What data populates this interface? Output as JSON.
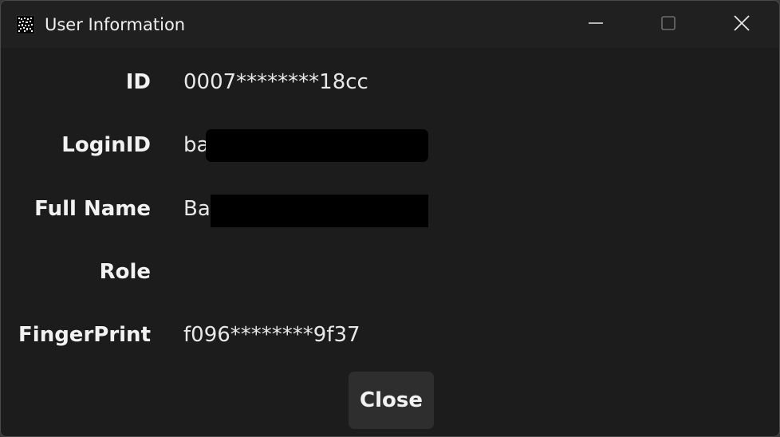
{
  "window": {
    "title": "User Information",
    "app_icon": "qr-pattern-icon",
    "controls": {
      "minimize_icon": "minimize-icon",
      "maximize_icon": "maximize-icon",
      "close_icon": "close-icon"
    }
  },
  "fields": [
    {
      "label": "ID",
      "value": "0007********18cc",
      "redacted": false
    },
    {
      "label": "LoginID",
      "value": "ba",
      "redacted": true
    },
    {
      "label": "Full Name",
      "value": "Ba",
      "redacted": true
    },
    {
      "label": "Role",
      "value": "",
      "redacted": false
    },
    {
      "label": "FingerPrint",
      "value": "f096********9f37",
      "redacted": false
    }
  ],
  "actions": {
    "close_label": "Close"
  },
  "colors": {
    "background": "#1c1c1c",
    "titlebar": "#202020",
    "button": "#2e2e2e",
    "text": "#f2f2f2",
    "redaction": "#000000"
  }
}
